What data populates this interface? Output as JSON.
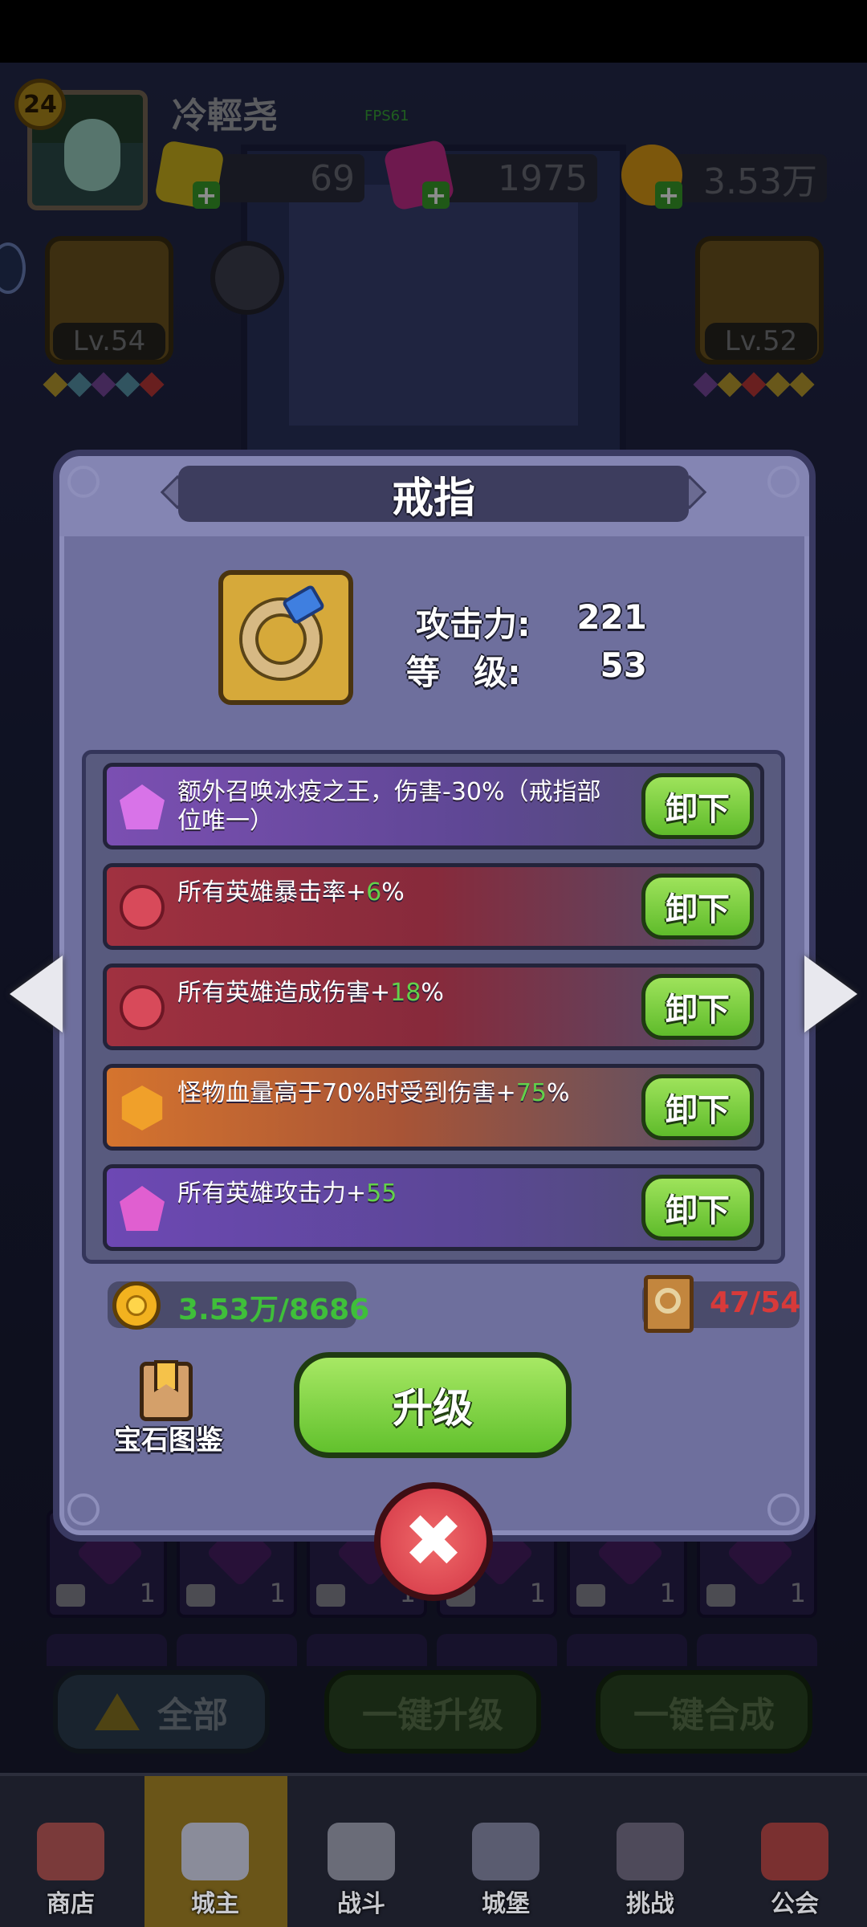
{
  "player": {
    "level": "24",
    "name": "冷輕尧",
    "fps": "FPS61"
  },
  "resources": {
    "gems_yellow": "69",
    "gems_pink": "1975",
    "gold": "3.53万"
  },
  "slots": {
    "left_level": "Lv.54",
    "right_level": "Lv.52"
  },
  "dialog": {
    "title": "戒指",
    "attack_label": "攻击力:",
    "attack_value": "221",
    "level_label": "等　级:",
    "level_value": "53",
    "gems": [
      {
        "text_before": "额外召唤冰疫之王，伤害-30%（戒指部位唯一）",
        "highlight": "",
        "text_after": "",
        "button": "卸下",
        "icon": "purple-pentagon-icon"
      },
      {
        "text_before": "所有英雄暴击率+",
        "highlight": "6",
        "text_after": "%",
        "button": "卸下",
        "icon": "red-round-gem-icon"
      },
      {
        "text_before": "所有英雄造成伤害+",
        "highlight": "18",
        "text_after": "%",
        "button": "卸下",
        "icon": "red-round-gem-icon"
      },
      {
        "text_before": "怪物血量高于70%时受到伤害+",
        "highlight": "75",
        "text_after": "%",
        "button": "卸下",
        "icon": "orange-hexagon-gem-icon"
      },
      {
        "text_before": "所有英雄攻击力+",
        "highlight": "55",
        "text_after": "",
        "button": "卸下",
        "icon": "magenta-pentagon-gem-icon"
      }
    ],
    "cost_gold": "3.53万/8686",
    "scroll_count": "47/54",
    "gem_catalog_label": "宝石图鉴",
    "upgrade_label": "升级",
    "close_symbol": "✖"
  },
  "inventory_counts": [
    "1",
    "1",
    "1",
    "1",
    "1",
    "1"
  ],
  "bottom_buttons": {
    "all": "全部",
    "one_click_upgrade": "一键升级",
    "one_click_merge": "一键合成"
  },
  "nav": [
    {
      "label": "商店"
    },
    {
      "label": "城主"
    },
    {
      "label": "战斗"
    },
    {
      "label": "城堡"
    },
    {
      "label": "挑战"
    },
    {
      "label": "公会"
    }
  ],
  "colors": {
    "highlight_green": "#62d24a",
    "cost_green": "#3fbf3a",
    "scroll_red": "#d83a3a",
    "button_green": "#62c12d",
    "close_red": "#d23545"
  }
}
